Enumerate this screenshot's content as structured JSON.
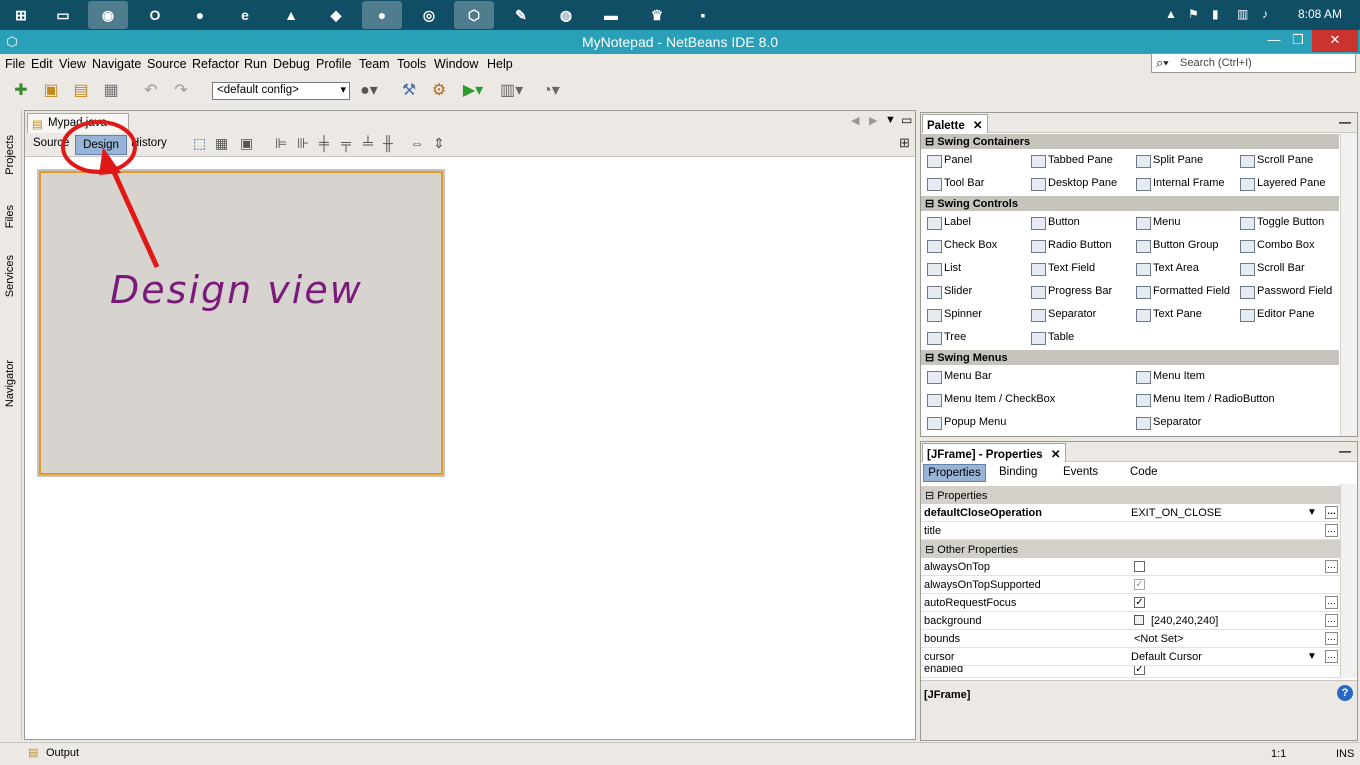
{
  "taskbar": {
    "time": "8:08 AM",
    "icons": [
      "windows-start-icon",
      "file-explorer-icon",
      "chrome-icon",
      "opera-icon",
      "firefox-icon",
      "ie-icon",
      "vlc-icon",
      "visual-studio-icon",
      "app-icon",
      "app-icon-2",
      "netbeans-icon",
      "notepad-icon",
      "app-icon-3",
      "app-icon-4",
      "app-icon-5",
      "app-icon-6"
    ]
  },
  "window": {
    "title": "MyNotepad - NetBeans IDE 8.0"
  },
  "menu": {
    "items": [
      "File",
      "Edit",
      "View",
      "Navigate",
      "Source",
      "Refactor",
      "Run",
      "Debug",
      "Profile",
      "Team",
      "Tools",
      "Window",
      "Help"
    ]
  },
  "search": {
    "placeholder": "Search (Ctrl+I)"
  },
  "toolbar": {
    "config": "<default config>"
  },
  "left_strip": {
    "labels": [
      "Projects",
      "Files",
      "Services",
      "Navigator"
    ]
  },
  "editor": {
    "tab_label": "Mypad.java",
    "subtabs": [
      "Source",
      "Design",
      "History"
    ],
    "annotation": "Design view"
  },
  "palette": {
    "title": "Palette",
    "categories": [
      {
        "name": "Swing Containers",
        "items": [
          "Panel",
          "Tabbed Pane",
          "Split Pane",
          "Scroll Pane",
          "Tool Bar",
          "Desktop Pane",
          "Internal Frame",
          "Layered Pane"
        ]
      },
      {
        "name": "Swing Controls",
        "items": [
          "Label",
          "Button",
          "Menu",
          "Toggle Button",
          "Check Box",
          "Radio Button",
          "Button Group",
          "Combo Box",
          "List",
          "Text Field",
          "Text Area",
          "Scroll Bar",
          "Slider",
          "Progress Bar",
          "Formatted Field",
          "Password Field",
          "Spinner",
          "Separator",
          "Text Pane",
          "Editor Pane",
          "Tree",
          "Table"
        ]
      },
      {
        "name": "Swing Menus",
        "items": [
          "Menu Bar",
          "Menu Item",
          "Menu Item / CheckBox",
          "Menu Item / RadioButton",
          "Popup Menu",
          "Separator"
        ]
      }
    ]
  },
  "properties": {
    "title": "[JFrame] - Properties",
    "tabs": [
      "Properties",
      "Binding",
      "Events",
      "Code"
    ],
    "sections": [
      "Properties",
      "Other Properties"
    ],
    "rows": [
      {
        "name": "defaultCloseOperation",
        "value": "EXIT_ON_CLOSE"
      },
      {
        "name": "title",
        "value": ""
      },
      {
        "name": "alwaysOnTop",
        "value": ""
      },
      {
        "name": "alwaysOnTopSupported",
        "value": "✓"
      },
      {
        "name": "autoRequestFocus",
        "value": "✓"
      },
      {
        "name": "background",
        "value": "[240,240,240]"
      },
      {
        "name": "bounds",
        "value": "<Not Set>"
      },
      {
        "name": "cursor",
        "value": "Default Cursor"
      },
      {
        "name": "enabled",
        "value": "✓"
      }
    ],
    "description": "[JFrame]"
  },
  "status": {
    "output": "Output",
    "position": "1:1",
    "mode": "INS"
  }
}
